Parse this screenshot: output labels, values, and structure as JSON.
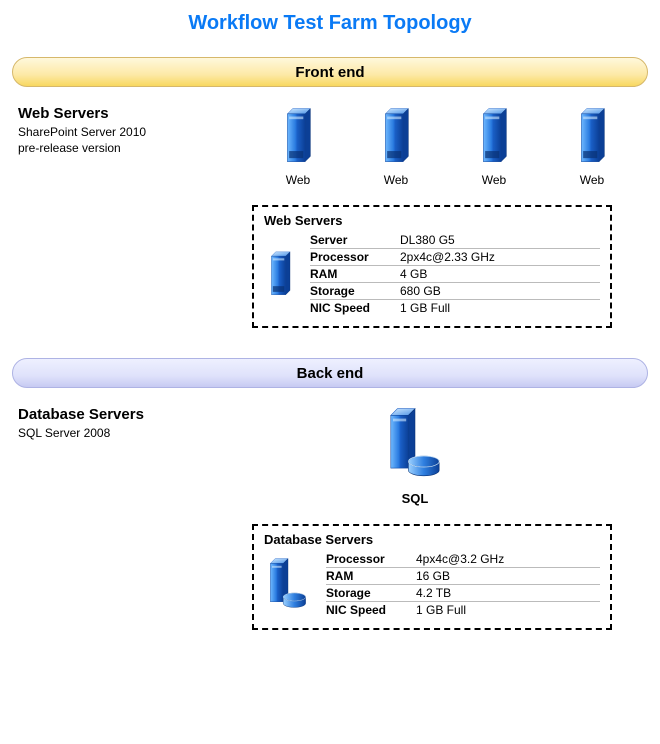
{
  "title": "Workflow Test Farm Topology",
  "front": {
    "header": "Front end",
    "heading": "Web Servers",
    "subline1": "SharePoint Server 2010",
    "subline2": "pre-release version",
    "servers": [
      "Web",
      "Web",
      "Web",
      "Web"
    ],
    "spec": {
      "title": "Web Servers",
      "rows": [
        {
          "k": "Server",
          "v": "DL380 G5"
        },
        {
          "k": "Processor",
          "v": "2px4c@2.33 GHz"
        },
        {
          "k": "RAM",
          "v": "4 GB"
        },
        {
          "k": "Storage",
          "v": "680 GB"
        },
        {
          "k": "NIC Speed",
          "v": "1 GB Full"
        }
      ]
    }
  },
  "back": {
    "header": "Back end",
    "heading": "Database Servers",
    "subline1": "SQL Server 2008",
    "server_label": "SQL",
    "spec": {
      "title": "Database Servers",
      "rows": [
        {
          "k": "Processor",
          "v": "4px4c@3.2 GHz"
        },
        {
          "k": "RAM",
          "v": "16 GB"
        },
        {
          "k": "Storage",
          "v": "4.2 TB"
        },
        {
          "k": "NIC Speed",
          "v": "1 GB Full"
        }
      ]
    }
  }
}
